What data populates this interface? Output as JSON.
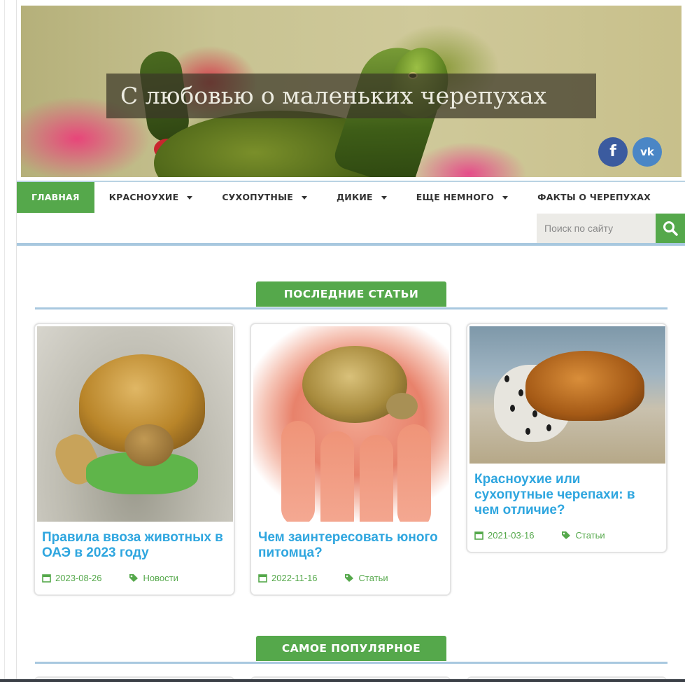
{
  "site": {
    "title": "С любовью о маленьких черепухах",
    "social": {
      "facebook_label": "f",
      "vk_label": "vk"
    }
  },
  "nav": {
    "items": [
      {
        "label": "ГЛАВНАЯ",
        "active": true,
        "dropdown": false
      },
      {
        "label": "КРАСНОУХИЕ",
        "active": false,
        "dropdown": true
      },
      {
        "label": "СУХОПУТНЫЕ",
        "active": false,
        "dropdown": true
      },
      {
        "label": "ДИКИЕ",
        "active": false,
        "dropdown": true
      },
      {
        "label": "ЕЩЕ НЕМНОГО",
        "active": false,
        "dropdown": true
      },
      {
        "label": "ФАКТЫ О ЧЕРЕПУХАХ",
        "active": false,
        "dropdown": false
      }
    ]
  },
  "search": {
    "placeholder": "Поиск по сайту"
  },
  "sections": {
    "latest": "ПОСЛЕДНИЕ СТАТЬИ",
    "popular": "САМОЕ ПОПУЛЯРНОЕ"
  },
  "articles": [
    {
      "title": "Правила ввоза животных в ОАЭ в 2023 году",
      "date": "2023-08-26",
      "category": "Новости"
    },
    {
      "title": "Чем заинтересовать юного питомца?",
      "date": "2022-11-16",
      "category": "Статьи"
    },
    {
      "title": "Красноухие или сухопутные черепахи: в чем отличие?",
      "date": "2021-03-16",
      "category": "Статьи"
    }
  ],
  "colors": {
    "accent_green": "#55a84b",
    "link_blue": "#2fa6df",
    "rule_blue": "#a8c8df",
    "facebook": "#3b5b9f",
    "vk": "#4a86c6"
  },
  "icons": [
    "facebook-icon",
    "vk-icon",
    "search-icon",
    "calendar-icon",
    "tags-icon",
    "caret-down-icon"
  ]
}
